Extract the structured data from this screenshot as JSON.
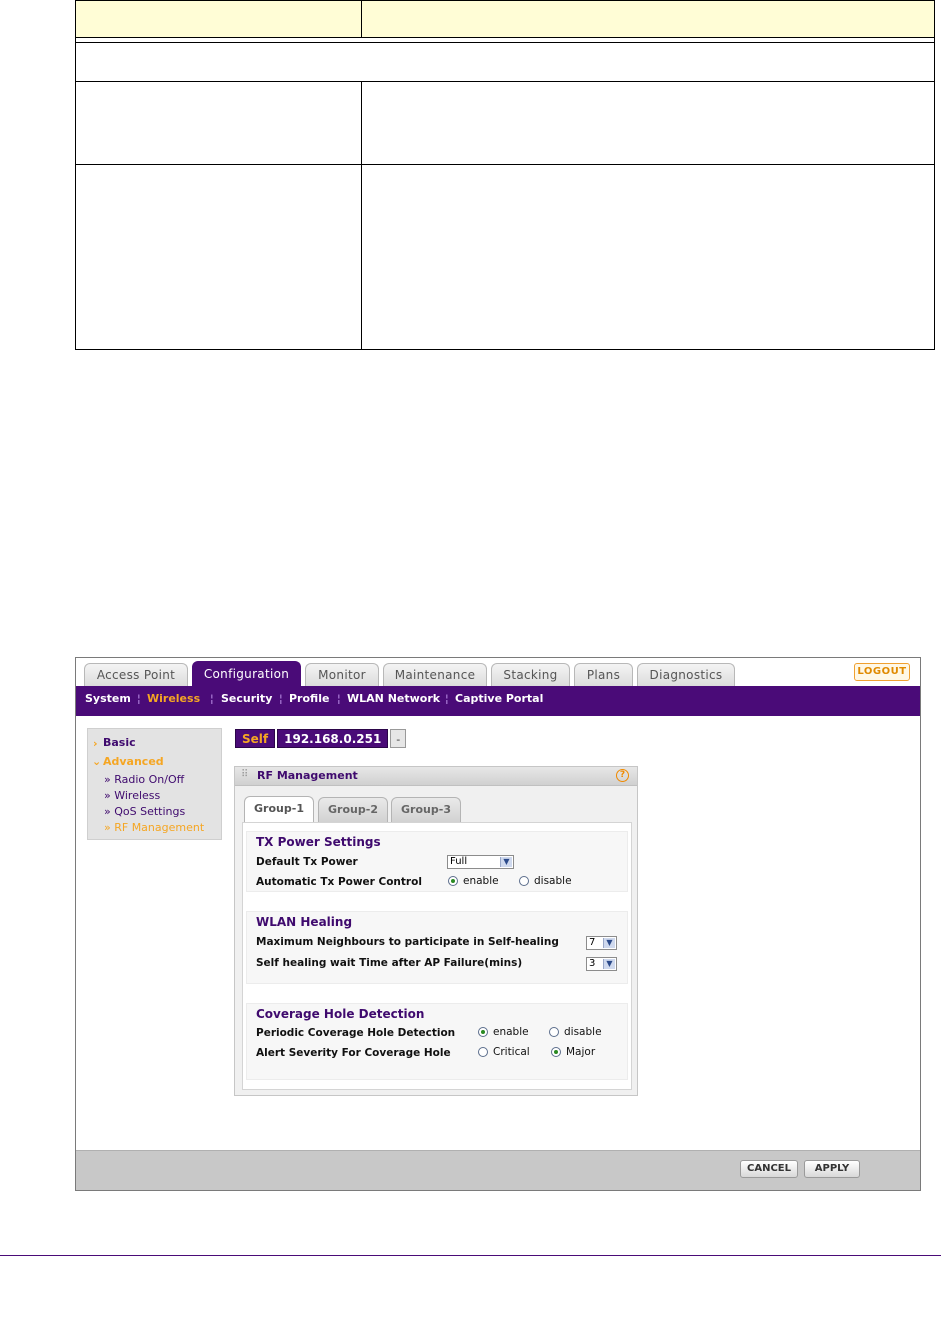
{
  "top_nav": {
    "tabs": [
      "Access Point",
      "Configuration",
      "Monitor",
      "Maintenance",
      "Stacking",
      "Plans",
      "Diagnostics"
    ],
    "active_tab": "Configuration",
    "logout_label": "LOGOUT"
  },
  "sub_nav": {
    "items": [
      "System",
      "Wireless",
      "Security",
      "Profile",
      "WLAN Network",
      "Captive Portal"
    ],
    "active_item": "Wireless"
  },
  "sidebar": {
    "basic": "Basic",
    "advanced": "Advanced",
    "sub_items": [
      "» Radio On/Off",
      "» Wireless",
      "» QoS Settings",
      "» RF Management"
    ],
    "active_sub_item": "» RF Management"
  },
  "ap_selector": {
    "self_label": "Self",
    "ip": "192.168.0.251",
    "dropdown_symbol": "-"
  },
  "panel": {
    "title": "RF Management",
    "help_symbol": "?",
    "group_tabs": [
      "Group-1",
      "Group-2",
      "Group-3"
    ],
    "active_group": "Group-1"
  },
  "tx_power": {
    "title": "TX Power Settings",
    "default_tx_label": "Default Tx Power",
    "default_tx_value": "Full",
    "auto_tx_label": "Automatic Tx Power Control",
    "enable_label": "enable",
    "disable_label": "disable",
    "auto_tx_selected": "enable"
  },
  "wlan_healing": {
    "title": "WLAN Healing",
    "max_neighbours_label": "Maximum Neighbours to participate in Self-healing",
    "max_neighbours_value": "7",
    "wait_time_label": "Self healing wait Time after AP Failure(mins)",
    "wait_time_value": "3"
  },
  "coverage_hole": {
    "title": "Coverage Hole Detection",
    "periodic_label": "Periodic Coverage Hole Detection",
    "enable_label": "enable",
    "disable_label": "disable",
    "periodic_selected": "enable",
    "alert_label": "Alert Severity For Coverage Hole",
    "critical_label": "Critical",
    "major_label": "Major",
    "alert_selected": "Major"
  },
  "footer": {
    "cancel_label": "CANCEL",
    "apply_label": "APPLY"
  }
}
